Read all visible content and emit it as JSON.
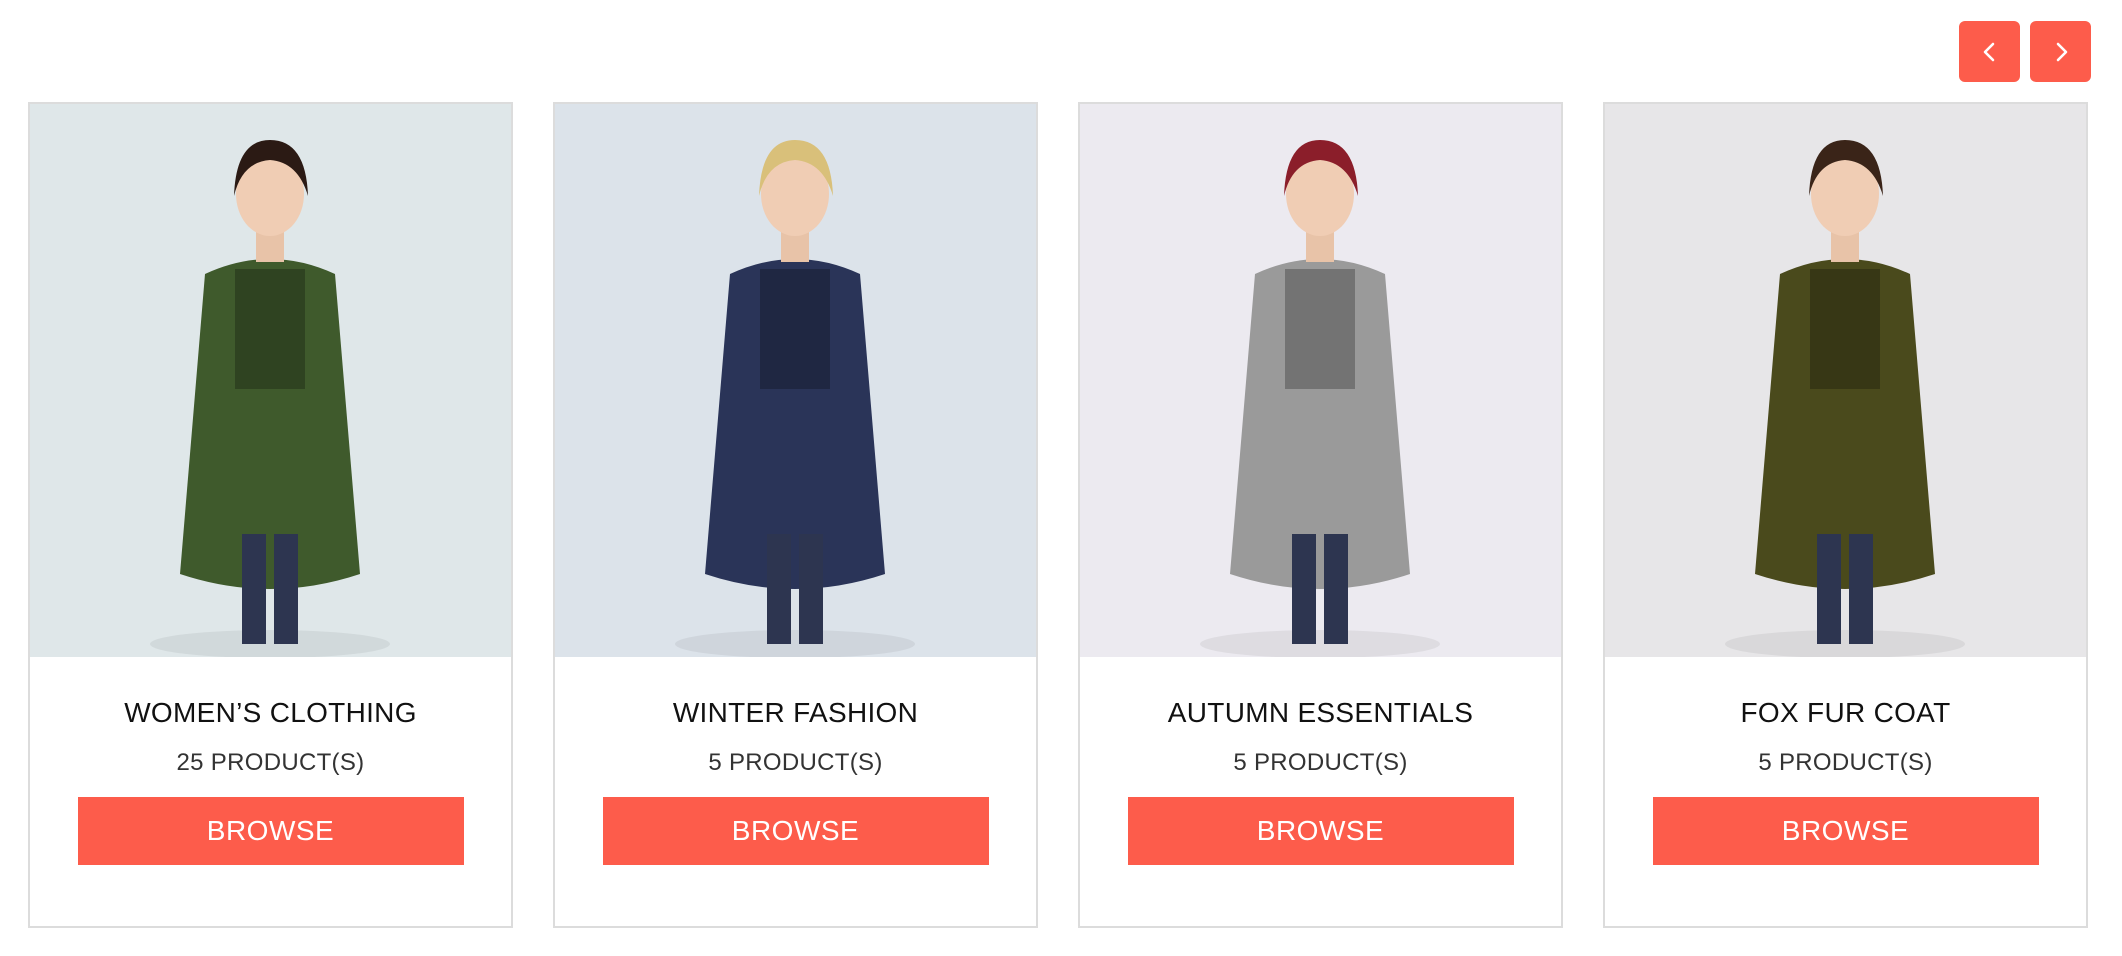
{
  "carousel": {
    "prev_icon": "chevron-left-icon",
    "next_icon": "chevron-right-icon",
    "accent_color": "#fd5c4b"
  },
  "cards": [
    {
      "title": "WOMEN’S CLOTHING",
      "count": "25 PRODUCT(S)",
      "button": "BROWSE",
      "image_bg": "#dfe7e9",
      "coat_color": "#3f5a2c",
      "hair_color": "#2b1a14"
    },
    {
      "title": "WINTER FASHION",
      "count": "5 PRODUCT(S)",
      "button": "BROWSE",
      "image_bg": "#dce3ea",
      "coat_color": "#2a3458",
      "hair_color": "#d9c07a"
    },
    {
      "title": "AUTUMN ESSENTIALS",
      "count": "5 PRODUCT(S)",
      "button": "BROWSE",
      "image_bg": "#eceaf0",
      "coat_color": "#9a9a9a",
      "hair_color": "#8b1e2a"
    },
    {
      "title": "FOX FUR COAT",
      "count": "5 PRODUCT(S)",
      "button": "BROWSE",
      "image_bg": "#e7e6e8",
      "coat_color": "#4a4a1c",
      "hair_color": "#3a2418"
    }
  ]
}
